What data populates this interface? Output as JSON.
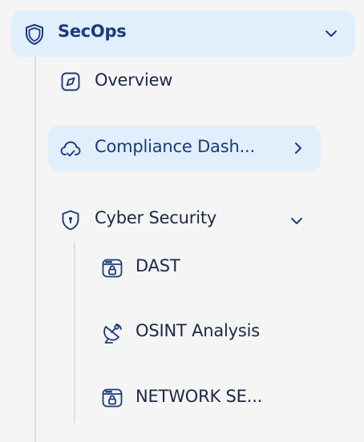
{
  "nav": {
    "group": {
      "label": "SecOps",
      "icon": "shield-icon",
      "expanded": true
    },
    "items": [
      {
        "label": "Overview",
        "icon": "compass-icon"
      },
      {
        "label": "Compliance Dash...",
        "icon": "cloud-check-icon",
        "active": true
      },
      {
        "label": "Cyber Security",
        "icon": "shield-keyhole-icon",
        "expanded": true
      }
    ],
    "subitems": [
      {
        "label": "DAST",
        "icon": "browser-lock-icon"
      },
      {
        "label": "OSINT Analysis",
        "icon": "satellite-dish-icon"
      },
      {
        "label": "NETWORK SE...",
        "icon": "browser-lock-icon"
      }
    ]
  },
  "colors": {
    "active_bg": "#e1effd",
    "active_text": "#1c3a7a",
    "text": "#1c2845",
    "icon": "#1c3a7a",
    "guide_line": "#dfe0e3",
    "page_bg": "#f5f5f6"
  }
}
